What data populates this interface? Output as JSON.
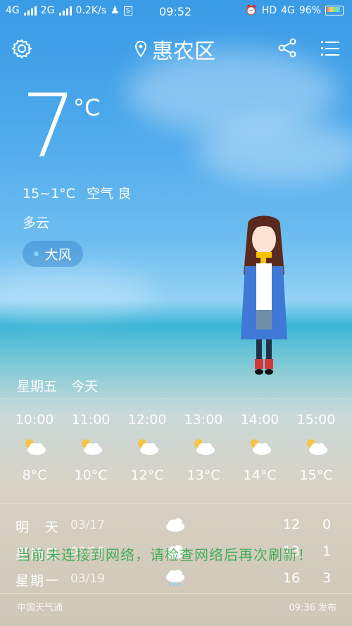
{
  "status_bar": {
    "left": "4G",
    "left2": "2G",
    "speed": "0.2K/s",
    "time": "09:52",
    "network": "HD",
    "network2": "4G",
    "battery": "96%"
  },
  "header": {
    "location": "惠农区"
  },
  "current": {
    "temperature": "7",
    "unit": "°C",
    "range": "15~1°C",
    "air_label": "空气",
    "air_value": "良",
    "condition": "多云",
    "badge": "大风"
  },
  "today": {
    "weekday": "星期五",
    "label": "今天"
  },
  "hourly": [
    {
      "time": "10:00",
      "temp": "8°C",
      "icon": "partly-cloudy-icon"
    },
    {
      "time": "11:00",
      "temp": "10°C",
      "icon": "partly-cloudy-icon"
    },
    {
      "time": "12:00",
      "temp": "12°C",
      "icon": "partly-cloudy-icon"
    },
    {
      "time": "13:00",
      "temp": "13°C",
      "icon": "partly-cloudy-icon"
    },
    {
      "time": "14:00",
      "temp": "14°C",
      "icon": "partly-cloudy-icon"
    },
    {
      "time": "15:00",
      "temp": "15°C",
      "icon": "partly-cloudy-icon"
    }
  ],
  "daily": [
    {
      "name": "明　天",
      "date": "03/17",
      "icon": "cloudy-icon",
      "high": "12",
      "low": "0"
    },
    {
      "name": "星期日",
      "date": "03/18",
      "icon": "cloudy-icon",
      "high": "13",
      "low": "1"
    },
    {
      "name": "星期一",
      "date": "03/19",
      "icon": "rain-icon",
      "high": "16",
      "low": "3"
    }
  ],
  "overlay": "当前未连接到网络，请检查网络后再次刷新！",
  "footer": {
    "source": "中国天气通",
    "published": "09:36 发布"
  }
}
